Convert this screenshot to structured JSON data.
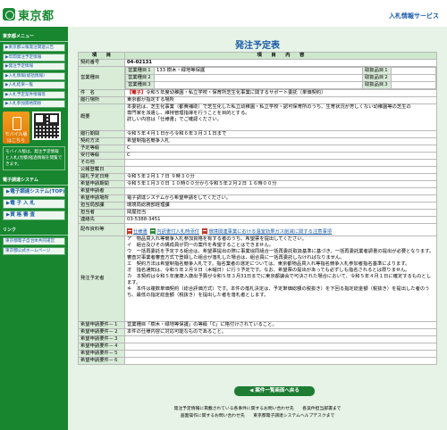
{
  "header": {
    "logo_text": "東京都",
    "link": "入札情報サービス"
  },
  "sidebar": {
    "section1": "東京都メニュー",
    "menu": [
      "▶東京都公報発注関連公告",
      "▶年間発注予定情報",
      "▶発注予定情報",
      "▶入札情報(総括情報)",
      "▶入札結果一覧",
      "▶入札予定案件情報等",
      "▶入札参加資格関係"
    ],
    "mobile_label": "モバイル版",
    "mobile_sub": "はこちら",
    "mobile_note": "モバイル版は、発注予定情報と入札(見積)経過情報を閲覧できます。",
    "section2": "電子調達システム",
    "big_links": [
      "▶電子調達システム(TOP)",
      "▶電 子 入 札",
      "▶資 格 審 査"
    ],
    "section3": "リンク",
    "sub_links": [
      "東京都電子自治体共同運営",
      "東京都公式ホームページ"
    ]
  },
  "main": {
    "title": "発注予定表",
    "col_item": "項　　目",
    "col_content": "項　　目　　内　　容",
    "contract_no_label": "契約番号",
    "contract_no": "04-02131",
    "biz_type_label": "営業種目",
    "biz1": {
      "k1": "営業種目１",
      "v1": "133 樹木・緑地等保護",
      "k2": "取扱品目１",
      "v2": ""
    },
    "biz2": {
      "k1": "営業種目２",
      "v1": "",
      "k2": "取扱品目２",
      "v2": ""
    },
    "biz3": {
      "k1": "営業種目３",
      "v1": "",
      "k2": "取扱品目３",
      "v2": ""
    },
    "subject_label": "件　名",
    "subject_tag": "【電子】",
    "subject_text": "令和５年度幼稚園・私立学校・保育所芝生化事業に関するサポート委託（単価契約）",
    "office_label": "履行場所",
    "office": "東京都が指定する場所",
    "summary_label": "概要",
    "summary": "本委託は、芝生化事業（都費補助）で芝生化した私立幼稚園・私立学校・認可保育所のうち、生育状況が芳しくない幼稚園等の芝生の\n専門家を派遣し、維持管理指導を行うことを目的とする。\n詳しい内容は「仕様書」でご確認ください。",
    "period_label": "履行期間",
    "period": "令和５年４月１日から令和６年３月３１日まで",
    "method_label": "契約方法",
    "method": "希望制指名競争入札",
    "grade_label": "予定等級",
    "grade": "C",
    "recv_grade_label": "受付等級",
    "recv_grade": "C",
    "other_label": "その他",
    "other": "",
    "public_label": "公報登載日",
    "public": "",
    "open_label": "開札予定日時",
    "open": "令和５年２月１７日 ９時３０分",
    "apply_period_label": "希望申請期間",
    "apply_period": "令和５年１月３０日 １０時００分から令和５年２月２日 １６時００分",
    "apply_proc_label": "希望申請者",
    "apply_proc": "",
    "apply_method_label": "希望申請場所",
    "apply_method": "電子調達システムから希望申請をしてください。",
    "dept_label": "担当局部課",
    "dept": "環境局総務部経理課",
    "person_label": "担当者",
    "person": "岡屋担当",
    "tel_label": "連絡先",
    "tel": "03-5388-3451",
    "docs_label": "配布資料等",
    "docs": [
      "仕様書",
      "内訳書付入札時添付",
      "環境関連事業における温室効果ガス削減に関する注意事項"
    ],
    "conditions_label": "発注予定者",
    "conditions": "ア　物品買入れ等競争入札参加資格を有する者のうち、希望票を提出してください。\nイ　組合及びその構成員が同一の案件を希望することはできません。\nウ　一括再委託を予定する組合は、希望票提出の際に事業協同組合一括再委託取扱基準に基づき、一括再委託業者調書の提出が必要となります。審査対事業者審査方式で登録した組合が落札した場合は、組合員に一括再委託しなければなりません。\nエ　契約方法は希望制指名競争入札です。指名業者の選定については、東京都物品買入れ等指名競争入札参加者指名基準によります。\nオ　指名通知は、令和５年２月９日（木曜日）に行う予定です。なお、希望票の提出があっても必ずしも指名されるとは限りません。\nカ　本契約は令和５年度歳入歳出予算が令和５年３月31日までに東京都議会で可決された場合において、令和５年４月１日に確定するものとします。\nキ　本件は複数単価契約（総合評価方式）です。本件の落札決定は、予定単価総額の税抜き）を下回る指定総金額（税抜き）を提出した者のうち、最低の指定総金額（税抜き）を提出した者を落札者とします。",
    "req_rows": [
      {
        "label": "希望申請要件－１",
        "value": "営業種目「樹木・緑地等保護」の等級「C」に格付けされていること。"
      },
      {
        "label": "希望申請要件－２",
        "value": "本件の仕様内容に対応可能なものであること。"
      },
      {
        "label": "希望申請要件－３",
        "value": ""
      },
      {
        "label": "希望申請要件－４",
        "value": ""
      },
      {
        "label": "希望申請要件－５",
        "value": ""
      },
      {
        "label": "希望申請要件－６",
        "value": ""
      }
    ],
    "back_button": "◀ 案件一覧画面へ戻る",
    "footer1": "発注予定情報に掲載されている各事件に関するお問い合わせ先　　各案件担当部署まで",
    "footer2": "画面操作に関するお問い合わせ先　　東京都電子調達システムヘルプデスクまで"
  }
}
